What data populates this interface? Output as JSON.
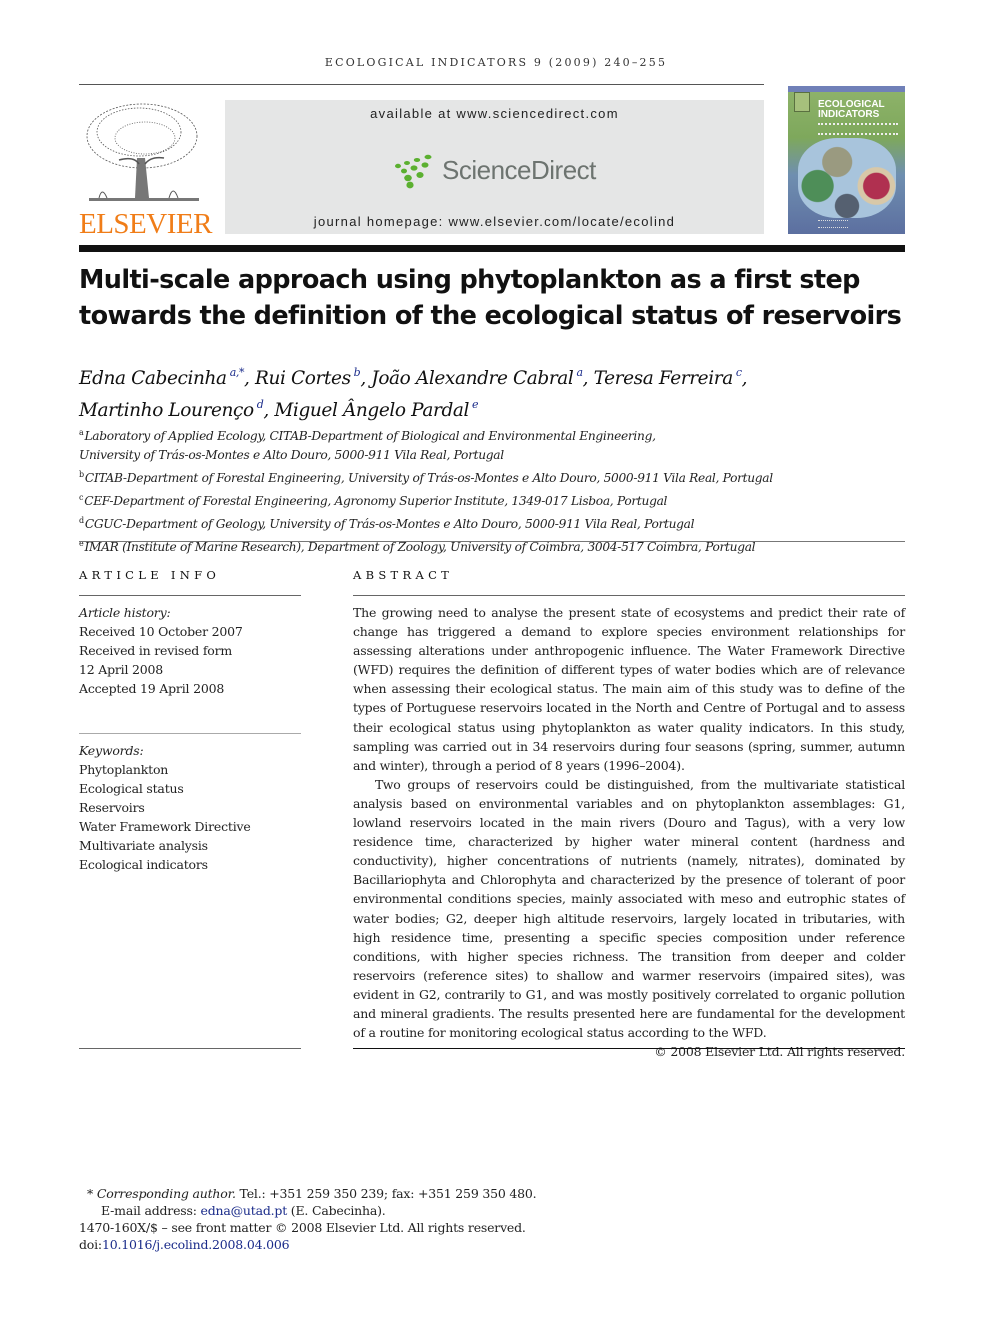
{
  "running_head": "ECOLOGICAL INDICATORS 9 (2009) 240–255",
  "publisher": {
    "name": "ELSEVIER",
    "logo_icon": "elsevier-tree-icon",
    "brand_color": "#f07d18"
  },
  "sciencedirect_banner": {
    "available_text": "available at www.sciencedirect.com",
    "logo_text": "ScienceDirect",
    "logo_icon": "sciencedirect-dots-icon",
    "dot_color": "#5bb030",
    "homepage_text": "journal homepage: www.elsevier.com/locate/ecolind"
  },
  "journal_cover": {
    "title_line1": "ECOLOGICAL",
    "title_line2": "INDICATORS"
  },
  "article": {
    "title": "Multi-scale approach using phytoplankton as a first step towards the definition of the ecological status of reservoirs",
    "authors": [
      {
        "name": "Edna Cabecinha",
        "marks": "a,*",
        "sep": ", "
      },
      {
        "name": "Rui Cortes",
        "marks": "b",
        "sep": ", "
      },
      {
        "name": "João Alexandre Cabral",
        "marks": "a",
        "sep": ", "
      },
      {
        "name": "Teresa Ferreira",
        "marks": "c",
        "sep": ","
      },
      {
        "name": "Martinho Lourenço",
        "marks": "d",
        "sep": ", "
      },
      {
        "name": "Miguel Ângelo Pardal",
        "marks": "e",
        "sep": ""
      }
    ],
    "affiliations": [
      {
        "mark": "a",
        "line1": "Laboratory of Applied Ecology, CITAB-Department of Biological and Environmental Engineering,",
        "line2": "University of Trás-os-Montes e Alto Douro, 5000-911 Vila Real, Portugal"
      },
      {
        "mark": "b",
        "line1": "CITAB-Department of Forestal Engineering, University of Trás-os-Montes e Alto Douro, 5000-911 Vila Real, Portugal"
      },
      {
        "mark": "c",
        "line1": "CEF-Department of Forestal Engineering, Agronomy Superior Institute, 1349-017 Lisboa, Portugal"
      },
      {
        "mark": "d",
        "line1": "CGUC-Department of Geology, University of Trás-os-Montes e Alto Douro, 5000-911 Vila Real, Portugal"
      },
      {
        "mark": "e",
        "line1": "IMAR (Institute of Marine Research), Department of Zoology, University of Coimbra, 3004-517 Coimbra, Portugal"
      }
    ]
  },
  "article_info": {
    "heading": "ARTICLE INFO",
    "history_label": "Article history:",
    "history": [
      "Received 10 October 2007",
      "Received in revised form",
      "12 April 2008",
      "Accepted 19 April 2008"
    ],
    "keywords_label": "Keywords:",
    "keywords": [
      "Phytoplankton",
      "Ecological status",
      "Reservoirs",
      "Water Framework Directive",
      "Multivariate analysis",
      "Ecological indicators"
    ]
  },
  "abstract": {
    "heading": "ABSTRACT",
    "paragraph1": "The growing need to analyse the present state of ecosystems and predict their rate of change has triggered a demand to explore species environment relationships for assessing alterations under anthropogenic influence. The Water Framework Directive (WFD) requires the definition of different types of water bodies which are of relevance when assessing their ecological status. The main aim of this study was to define of the types of Portuguese reservoirs located in the North and Centre of Portugal and to assess their ecological status using phytoplankton as water quality indicators. In this study, sampling was carried out in 34 reservoirs during four seasons (spring, summer, autumn and winter), through a period of 8 years (1996–2004).",
    "paragraph2": "Two groups of reservoirs could be distinguished, from the multivariate statistical analysis based on environmental variables and on phytoplankton assemblages: G1, lowland reservoirs located in the main rivers (Douro and Tagus), with a very low residence time, characterized by higher water mineral content (hardness and conductivity), higher concentrations of nutrients (namely, nitrates), dominated by Bacillariophyta and Chlorophyta and characterized by the presence of tolerant of poor environmental conditions species, mainly associated with meso and eutrophic states of water bodies; G2, deeper high altitude reservoirs, largely located in tributaries, with high residence time, presenting a specific species composition under reference conditions, with higher species richness. The transition from deeper and colder reservoirs (reference sites) to shallow and warmer reservoirs (impaired sites), was evident in G2, contrarily to G1, and was mostly positively correlated to organic pollution and mineral gradients. The results presented here are fundamental for the development of a routine for monitoring ecological status according to the WFD.",
    "copyright": "© 2008 Elsevier Ltd. All rights reserved."
  },
  "footnotes": {
    "star": "*",
    "corresponding_label": "Corresponding author.",
    "contact": " Tel.: +351 259 350 239; fax: +351 259 350 480.",
    "email_label": "E-mail address: ",
    "email": "edna@utad.pt",
    "email_suffix": " (E. Cabecinha).",
    "front_matter": "1470-160X/$ – see front matter © 2008 Elsevier Ltd. All rights reserved.",
    "doi_label": "doi:",
    "doi": "10.1016/j.ecolind.2008.04.006"
  }
}
